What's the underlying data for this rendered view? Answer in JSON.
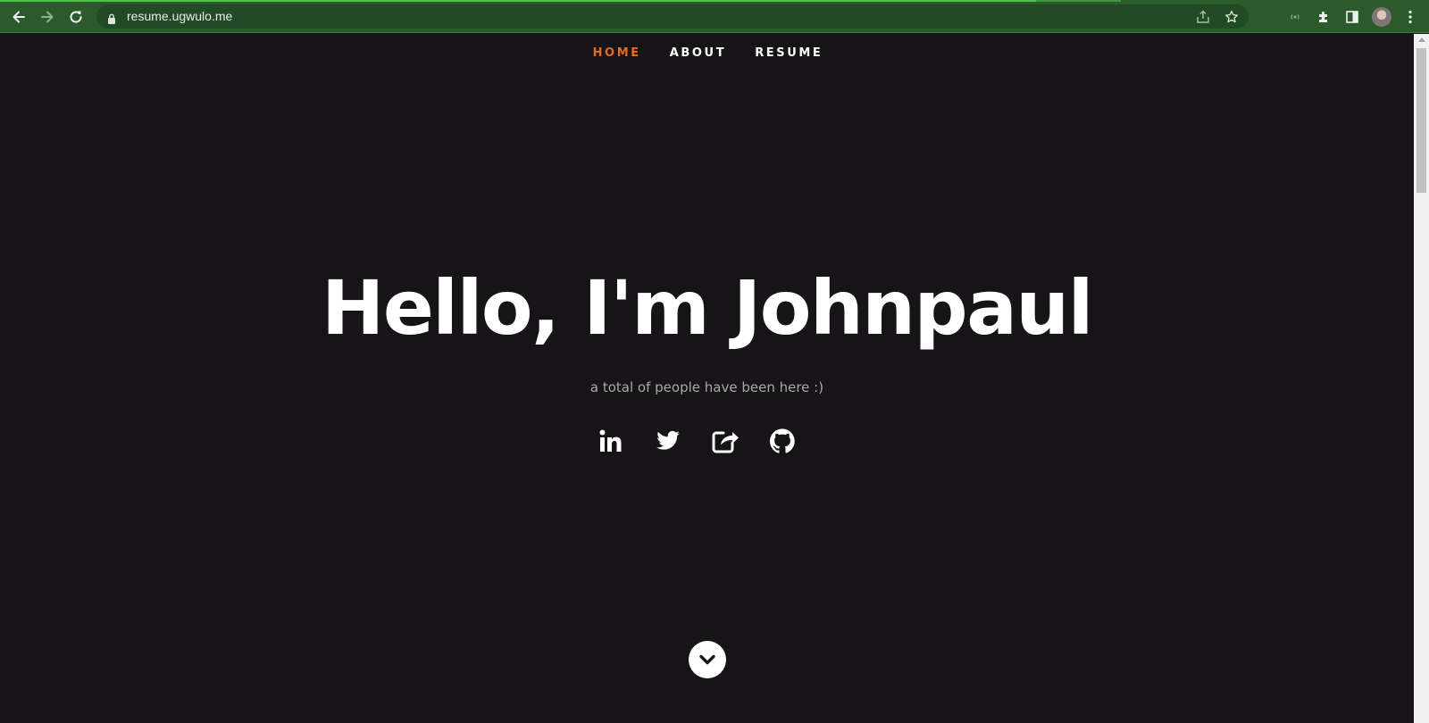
{
  "browser": {
    "url": "resume.ugwulo.me",
    "icons": {
      "back": "arrow-left-icon",
      "forward": "arrow-right-icon",
      "reload": "reload-icon",
      "lock": "lock-icon",
      "share": "share-icon",
      "bookmark": "star-icon",
      "cast": "cast-icon",
      "extensions": "puzzle-icon",
      "side_panel": "side-panel-icon",
      "menu": "kebab-menu-icon"
    }
  },
  "nav": {
    "items": [
      {
        "label": "HOME",
        "active": true
      },
      {
        "label": "ABOUT",
        "active": false
      },
      {
        "label": "RESUME",
        "active": false
      }
    ]
  },
  "hero": {
    "title": "Hello, I'm Johnpaul",
    "subtitle": "a total of people have been here :)"
  },
  "socials": [
    "linkedin-icon",
    "twitter-icon",
    "external-link-icon",
    "github-icon"
  ],
  "colors": {
    "accent": "#e86a1f",
    "page_bg": "#161416",
    "chrome_bg": "#2b5a2c"
  }
}
